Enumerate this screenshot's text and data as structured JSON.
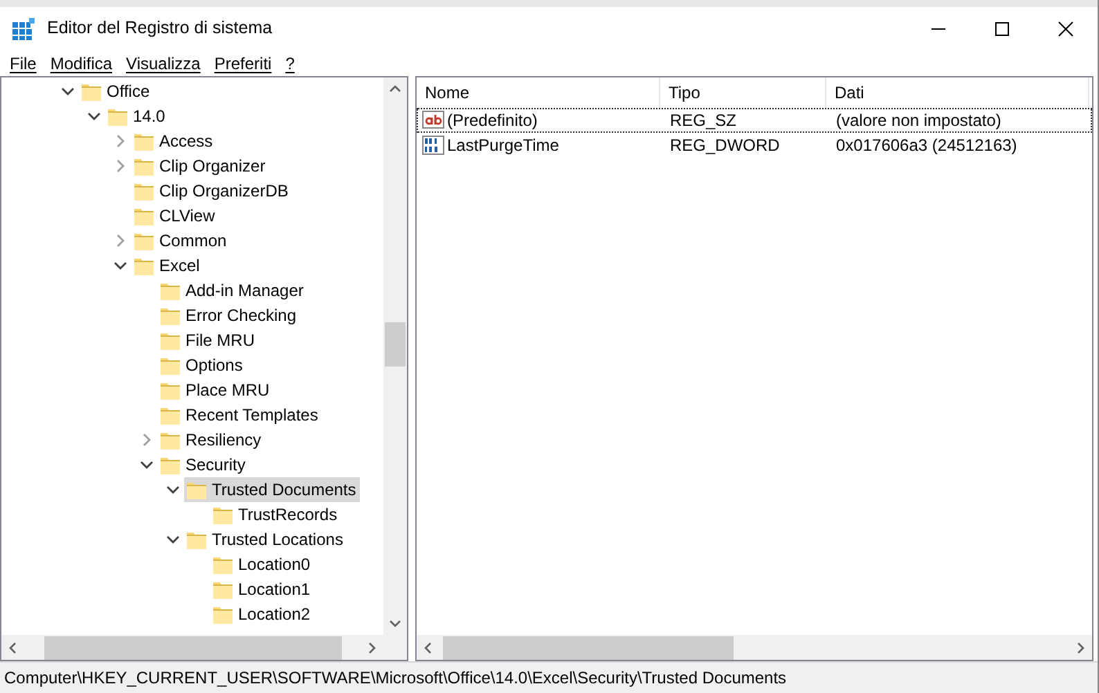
{
  "window": {
    "title": "Editor del Registro di sistema"
  },
  "menu": [
    "File",
    "Modifica",
    "Visualizza",
    "Preferiti",
    "?"
  ],
  "tree": [
    {
      "label": "Office",
      "expandable": true,
      "expanded": true,
      "selected": false,
      "children": [
        {
          "label": "14.0",
          "expandable": true,
          "expanded": true,
          "selected": false,
          "children": [
            {
              "label": "Access",
              "expandable": true,
              "expanded": false,
              "selected": false
            },
            {
              "label": "Clip Organizer",
              "expandable": true,
              "expanded": false,
              "selected": false
            },
            {
              "label": "Clip OrganizerDB",
              "expandable": false,
              "selected": false
            },
            {
              "label": "CLView",
              "expandable": false,
              "selected": false
            },
            {
              "label": "Common",
              "expandable": true,
              "expanded": false,
              "selected": false
            },
            {
              "label": "Excel",
              "expandable": true,
              "expanded": true,
              "selected": false,
              "children": [
                {
                  "label": "Add-in Manager",
                  "expandable": false,
                  "selected": false
                },
                {
                  "label": "Error Checking",
                  "expandable": false,
                  "selected": false
                },
                {
                  "label": "File MRU",
                  "expandable": false,
                  "selected": false
                },
                {
                  "label": "Options",
                  "expandable": false,
                  "selected": false
                },
                {
                  "label": "Place MRU",
                  "expandable": false,
                  "selected": false
                },
                {
                  "label": "Recent Templates",
                  "expandable": false,
                  "selected": false
                },
                {
                  "label": "Resiliency",
                  "expandable": true,
                  "expanded": false,
                  "selected": false
                },
                {
                  "label": "Security",
                  "expandable": true,
                  "expanded": true,
                  "selected": false,
                  "children": [
                    {
                      "label": "Trusted Documents",
                      "expandable": true,
                      "expanded": true,
                      "selected": true,
                      "children": [
                        {
                          "label": "TrustRecords",
                          "expandable": false,
                          "selected": false
                        }
                      ]
                    },
                    {
                      "label": "Trusted Locations",
                      "expandable": true,
                      "expanded": true,
                      "selected": false,
                      "children": [
                        {
                          "label": "Location0",
                          "expandable": false,
                          "selected": false
                        },
                        {
                          "label": "Location1",
                          "expandable": false,
                          "selected": false
                        },
                        {
                          "label": "Location2",
                          "expandable": false,
                          "selected": false
                        }
                      ]
                    }
                  ]
                }
              ]
            }
          ]
        }
      ]
    }
  ],
  "table": {
    "columns": [
      "Nome",
      "Tipo",
      "Dati"
    ],
    "rows": [
      {
        "kind": "string",
        "name": "(Predefinito)",
        "type": "REG_SZ",
        "data": "(valore non impostato)",
        "selected": false,
        "focused": true
      },
      {
        "kind": "binary",
        "name": "LastPurgeTime",
        "type": "REG_DWORD",
        "data": "0x017606a3 (24512163)",
        "selected": false,
        "focused": false
      }
    ]
  },
  "status_bar": "Computer\\HKEY_CURRENT_USER\\SOFTWARE\\Microsoft\\Office\\14.0\\Excel\\Security\\Trusted Documents"
}
